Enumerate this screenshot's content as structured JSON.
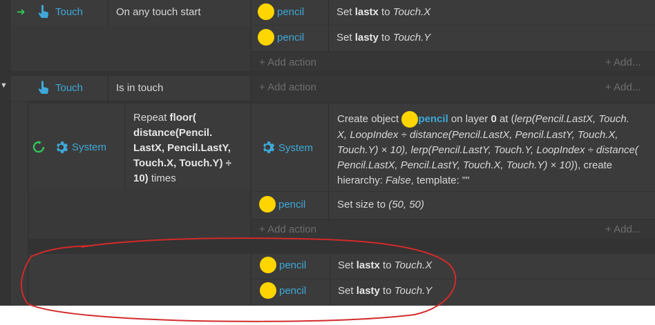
{
  "colors": {
    "accent_blue": "#3ea8d8",
    "pencil_yellow": "#ffd500",
    "annotation_red": "#d42a2a",
    "arrow_green": "#33c75a"
  },
  "event1": {
    "object": "Touch",
    "condition": "On any touch start",
    "actions": [
      {
        "object": "pencil",
        "pre": "Set ",
        "var": "lastx",
        "mid": " to ",
        "val": "Touch.X"
      },
      {
        "object": "pencil",
        "pre": "Set ",
        "var": "lasty",
        "mid": " to ",
        "val": "Touch.Y"
      }
    ],
    "add_action": "+ Add action",
    "add_more": "+ Add..."
  },
  "event2": {
    "object": "Touch",
    "condition": "Is in touch",
    "add_action": "+ Add action",
    "add_more": "+ Add...",
    "sub": {
      "object": "System",
      "cond_pre": "Repeat ",
      "cond_line1": "floor(",
      "cond_line2": "distance(Pencil.",
      "cond_line3": "LastX, Pencil.LastY,",
      "cond_line4": "Touch.X, Touch.Y) ÷",
      "cond_line5a": "10)",
      "cond_line5b": " times",
      "action1_object": "System",
      "create_pre": "Create object ",
      "create_obj": "pencil",
      "create_mid": " on layer ",
      "create_layer": "0",
      "create_at": " at (",
      "create_line1": "lerp(Pencil.LastX, Touch.",
      "create_line2": "X, LoopIndex ÷ distance(Pencil.LastX, Pencil.LastY, Touch.X,",
      "create_line3": "Touch.Y) × 10), lerp(Pencil.LastY, Touch.Y, LoopIndex ÷ distance(",
      "create_line4": "Pencil.LastX, Pencil.LastY, Touch.X, Touch.Y) × 10)",
      "create_line4b": "), create",
      "create_line5a": "hierarchy: ",
      "create_line5b": "False",
      "create_line5c": ", template: \"\"",
      "action2_object": "pencil",
      "action2_text": "Set size to ",
      "action2_val": "(50, 50)",
      "add_action": "+ Add action",
      "add_more": "+ Add..."
    },
    "extra_actions": [
      {
        "object": "pencil",
        "pre": "Set ",
        "var": "lastx",
        "mid": " to ",
        "val": "Touch.X"
      },
      {
        "object": "pencil",
        "pre": "Set ",
        "var": "lasty",
        "mid": " to ",
        "val": "Touch.Y"
      }
    ]
  }
}
